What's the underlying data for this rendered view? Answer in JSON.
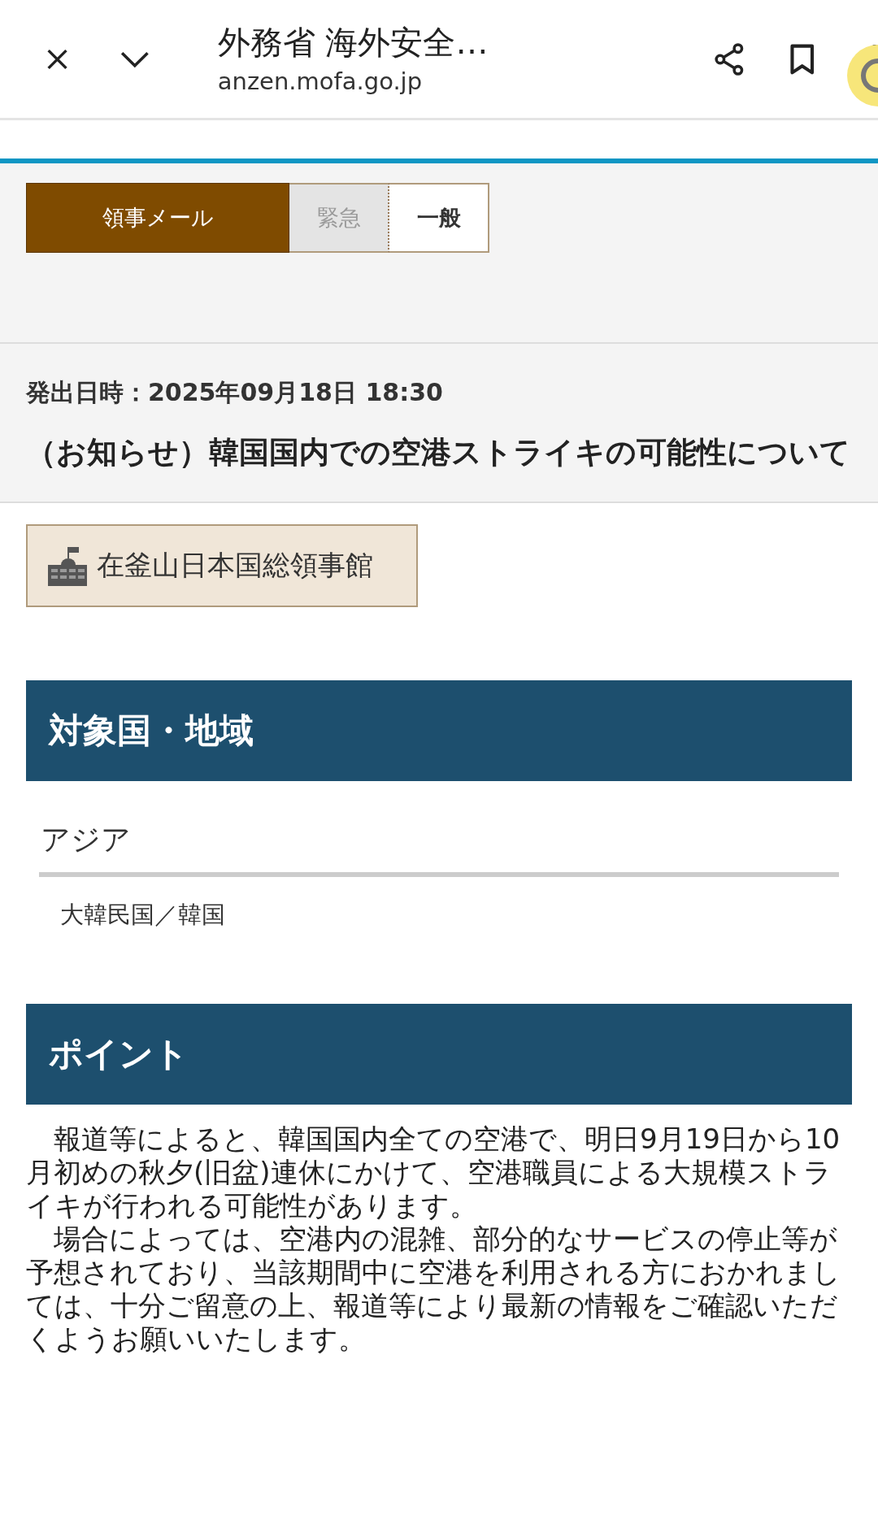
{
  "browser": {
    "title": "外務省 海外安全…",
    "url": "anzen.mofa.go.jp"
  },
  "mail_header": {
    "label": "領事メール",
    "tabs": [
      {
        "label": "緊急",
        "selected": false
      },
      {
        "label": "一般",
        "selected": true
      }
    ]
  },
  "notice": {
    "issued": "発出日時：2025年09月18日 18:30",
    "title": "（お知らせ）韓国国内での空港ストライキの可能性について"
  },
  "sender": "在釜山日本国総領事館",
  "sections": [
    {
      "heading": "対象国・地域",
      "kind": "region",
      "region": "アジア",
      "country": "大韓民国／韓国"
    },
    {
      "heading": "ポイント",
      "kind": "text",
      "paragraphs": [
        "　報道等によると、韓国国内全ての空港で、明日9月19日から10月初めの秋夕(旧盆)連休にかけて、空港職員による大規模ストライキが行われる可能性があります。",
        "　場合によっては、空港内の混雑、部分的なサービスの停止等が予想されており、当該期間中に空港を利用される方におかれましては、十分ご留意の上、報道等により最新の情報をご確認いただくようお願いいたします。"
      ]
    }
  ]
}
